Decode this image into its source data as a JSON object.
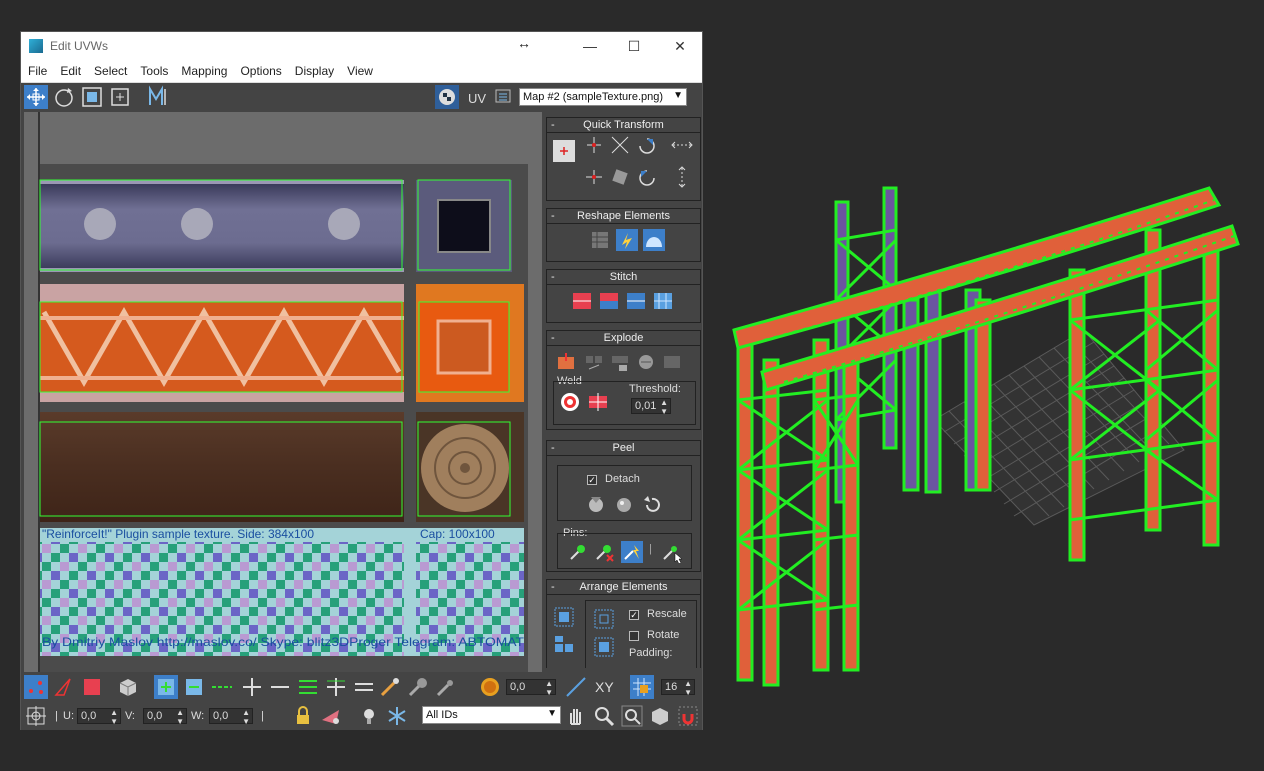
{
  "window": {
    "title": "Edit UVWs",
    "resize_glyph": "↔",
    "min": "—",
    "max": "☐",
    "close": "✕"
  },
  "menu": [
    "File",
    "Edit",
    "Select",
    "Tools",
    "Mapping",
    "Options",
    "Display",
    "View"
  ],
  "toolbar": {
    "uv_label": "UV",
    "map_select": "Map #2 (sampleTexture.png)",
    "tools": [
      "move-tool-icon",
      "rotate-tool-icon",
      "scale-tool-icon",
      "freeform-tool-icon",
      "mirror-tool-icon"
    ]
  },
  "texture": {
    "caption_top": "\"ReinforceIt!\" Plugin sample texture. Side: 384x100",
    "caption_cap": "Cap: 100x100",
    "caption_bottom": "By Dmitriy Maslov http://maslov.co/ Skype: blitz3DProger Telegram: ABTOMAT"
  },
  "panels": {
    "quick_transform": {
      "title": "Quick Transform"
    },
    "reshape": {
      "title": "Reshape Elements"
    },
    "stitch": {
      "title": "Stitch"
    },
    "explode": {
      "title": "Explode",
      "weld_label": "Weld",
      "threshold_label": "Threshold:",
      "threshold_value": "0,01"
    },
    "peel": {
      "title": "Peel",
      "detach_label": "Detach",
      "detach_checked": true,
      "pins_label": "Pins:"
    },
    "arrange": {
      "title": "Arrange Elements",
      "rescale_label": "Rescale",
      "rescale_checked": true,
      "rotate_label": "Rotate",
      "rotate_checked": false,
      "padding_label": "Padding:"
    }
  },
  "bottom": {
    "value_field": "0,0",
    "xy_label": "XY",
    "grid_value": "16",
    "u_label": "U:",
    "u_value": "0,0",
    "v_label": "V:",
    "v_value": "0,0",
    "w_label": "W:",
    "w_value": "0,0",
    "ids_select": "All IDs"
  },
  "colors": {
    "accent": "#3d7fc9",
    "uv_edge": "#33ff33",
    "wire_green": "#22ee22",
    "plank_orange": "#e0603a"
  }
}
